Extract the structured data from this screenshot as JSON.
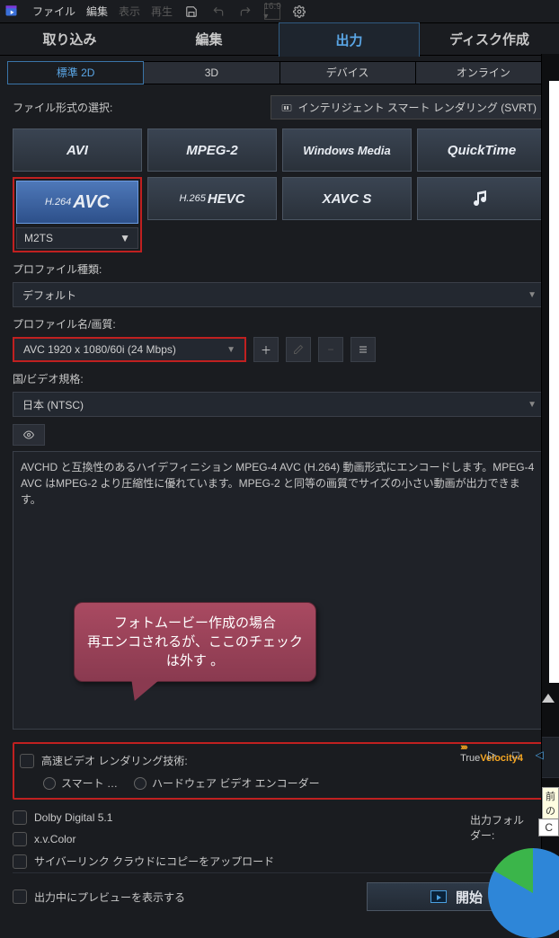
{
  "menubar": {
    "items": [
      "ファイル",
      "編集",
      "表示",
      "再生"
    ],
    "disabled_indices": [
      2,
      3
    ]
  },
  "maintabs": {
    "items": [
      "取り込み",
      "編集",
      "出力",
      "ディスク作成"
    ],
    "active_index": 2
  },
  "modetabs": {
    "items": [
      "標準 2D",
      "3D",
      "デバイス",
      "オンライン"
    ],
    "active_index": 0
  },
  "file_format": {
    "label": "ファイル形式の選択:",
    "svrt_button": "インテリジェント スマート レンダリング (SVRT)",
    "buttons": [
      {
        "label": "AVI"
      },
      {
        "label": "MPEG-2"
      },
      {
        "label": "Windows Media"
      },
      {
        "label": "QuickTime"
      },
      {
        "prefix": "H.264",
        "label": "AVC",
        "selected": true
      },
      {
        "prefix": "H.265",
        "label": "HEVC"
      },
      {
        "label": "XAVC S"
      },
      {
        "label": "♪♪",
        "music": true
      }
    ],
    "container": "M2TS"
  },
  "profile_type": {
    "label": "プロファイル種類:",
    "value": "デフォルト"
  },
  "profile_name": {
    "label": "プロファイル名/画質:",
    "value": "AVC 1920 x 1080/60i (24 Mbps)"
  },
  "region": {
    "label": "国/ビデオ規格:",
    "value": "日本 (NTSC)"
  },
  "description": "AVCHD と互換性のあるハイデフィニション MPEG-4 AVC (H.264) 動画形式にエンコードします。MPEG-4 AVC はMPEG-2 より圧縮性に優れています。MPEG-2 と同等の画質でサイズの小さい動画が出力できます。",
  "callout": "フォトムービー作成の場合\n再エンコされるが、ここのチェック\nは外す 。",
  "fast_render": {
    "title": "高速ビデオ レンダリング技術:",
    "radios": [
      "スマート …",
      "ハードウェア ビデオ エンコーダー"
    ]
  },
  "truevelocity": {
    "label": "Velocity",
    "prefix": "True",
    "suffix": "4"
  },
  "checkboxes": [
    "Dolby Digital 5.1",
    "x.v.Color",
    "サイバーリンク クラウドにコピーをアップロード"
  ],
  "bottom": {
    "preview_label": "出力中にプレビューを表示する",
    "start_label": "開始"
  },
  "right": {
    "output_folder_label": "出力フォルダー:",
    "output_value": "C",
    "tooltip": "前の"
  }
}
